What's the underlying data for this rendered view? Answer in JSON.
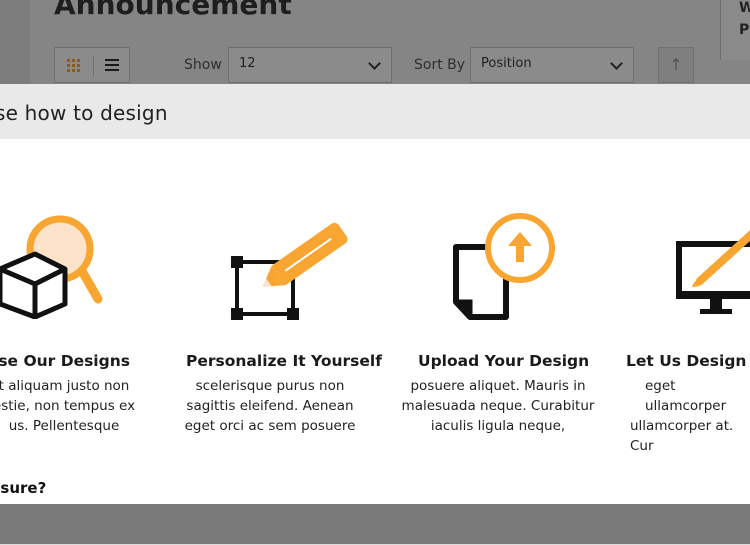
{
  "page": {
    "title": "Announcement",
    "right_col": [
      "W",
      "Pl"
    ]
  },
  "toolbar": {
    "show_label": "Show",
    "show_value": "12",
    "sort_label": "Sort By",
    "sort_value": "Position",
    "sort_dir_icon": "arrow-up"
  },
  "modal": {
    "title": "se how to design",
    "options": [
      {
        "title": "wse Our Designs",
        "lines": [
          "t aliquam justo non",
          "estie, non tempus ex",
          "us. Pellentesque"
        ],
        "icon": "box-magnifier-icon"
      },
      {
        "title": "Personalize It Yourself",
        "lines": [
          "scelerisque purus non",
          "sagittis eleifend. Aenean",
          "eget orci ac sem posuere"
        ],
        "icon": "pencil-frame-icon"
      },
      {
        "title": "Upload Your Design",
        "lines": [
          "posuere aliquet. Mauris in",
          "malesuada neque. Curabitur",
          "iaculis ligula neque,"
        ],
        "icon": "upload-document-icon"
      },
      {
        "title": "Let Us Design It",
        "lines": [
          "eget ullamcorper",
          "ullamcorper at. Cur"
        ],
        "icon": "monitor-brush-icon"
      }
    ],
    "footer_prompt": "t sure?"
  },
  "colors": {
    "accent": "#f8a531",
    "accent_light": "#fde3c9",
    "dark": "#111111"
  }
}
